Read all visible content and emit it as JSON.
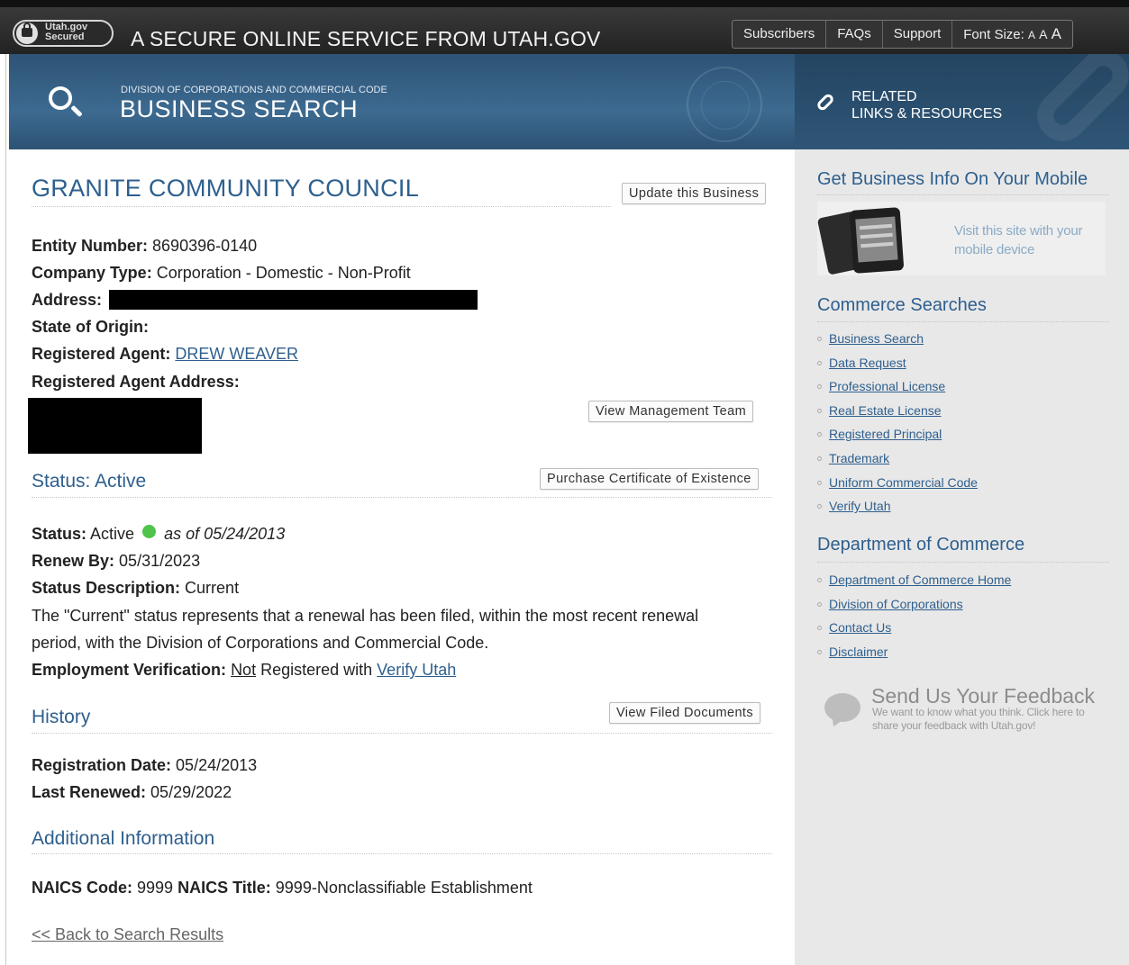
{
  "topbar": {
    "badge_line1": "Utah.gov",
    "badge_line2": "Secured",
    "title": "A SECURE ONLINE SERVICE FROM UTAH.GOV",
    "nav": [
      "Subscribers",
      "FAQs",
      "Support"
    ],
    "font_size_label": "Font Size:",
    "font_size_options": [
      "A",
      "A",
      "A"
    ]
  },
  "header": {
    "division": "DIVISION OF CORPORATIONS AND COMMERCIAL CODE",
    "title": "BUSINESS SEARCH",
    "related_line1": "RELATED",
    "related_line2": "LINKS & RESOURCES"
  },
  "entity": {
    "name": "GRANITE COMMUNITY COUNCIL",
    "update_button": "Update this Business",
    "entity_number_label": "Entity Number:",
    "entity_number": "8690396-0140",
    "company_type_label": "Company Type:",
    "company_type": "Corporation - Domestic - Non-Profit",
    "address_label": "Address:",
    "state_origin_label": "State of Origin:",
    "agent_label": "Registered Agent:",
    "agent_name": "DREW WEAVER",
    "agent_address_label": "Registered Agent Address:",
    "management_button": "View Management Team"
  },
  "status": {
    "heading": "Status: Active",
    "certificate_button": "Purchase Certificate of Existence",
    "status_label": "Status:",
    "status_value": "Active",
    "status_date": "as of 05/24/2013",
    "renew_label": "Renew By:",
    "renew_value": "05/31/2023",
    "description_label": "Status Description:",
    "description_value": "Current",
    "explanation_line1": "The \"Current\" status represents that a renewal has been filed, within the most recent renewal",
    "explanation_line2": "period, with the Division of Corporations and Commercial Code.",
    "employment_label": "Employment Verification:",
    "employment_not": "Not",
    "employment_mid": "Registered with",
    "employment_link": "Verify Utah"
  },
  "history": {
    "heading": "History",
    "documents_button": "View Filed Documents",
    "registration_label": "Registration Date:",
    "registration_value": "05/24/2013",
    "renewed_label": "Last Renewed:",
    "renewed_value": "05/29/2022"
  },
  "additional": {
    "heading": "Additional Information",
    "naics_code_label": "NAICS Code:",
    "naics_code": "9999",
    "naics_title_label": "NAICS Title:",
    "naics_title": "9999-Nonclassifiable Establishment",
    "back_link": "<< Back to Search Results"
  },
  "sidebar": {
    "mobile_heading": "Get Business Info On Your Mobile",
    "mobile_text": "Visit this site with your mobile device",
    "commerce_heading": "Commerce Searches",
    "commerce_links": [
      "Business Search",
      "Data Request",
      "Professional License",
      "Real Estate License",
      "Registered Principal",
      "Trademark",
      "Uniform Commercial Code",
      "Verify Utah"
    ],
    "department_heading": "Department of Commerce",
    "department_links": [
      "Department of Commerce Home",
      "Division of Corporations",
      "Contact Us",
      "Disclaimer"
    ],
    "feedback_title": "Send Us Your Feedback",
    "feedback_text": "We want to know what you think. Click here to share your feedback with Utah.gov!"
  },
  "colors": {
    "heading_blue": "#2e5f8e",
    "header_blue": "#3d6a90",
    "status_green": "#4fc34a",
    "sidebar_gray": "#e8e8e8"
  }
}
